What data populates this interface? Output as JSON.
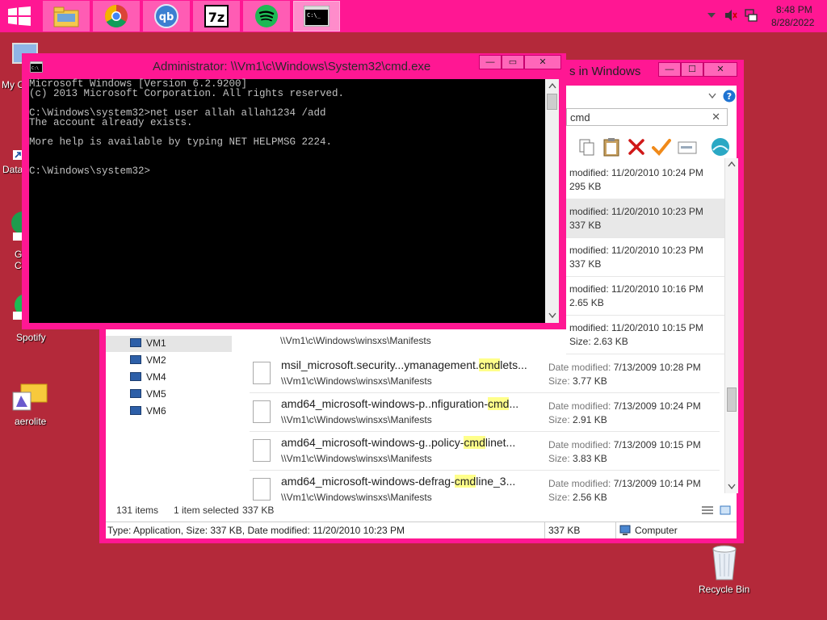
{
  "taskbar": {
    "clock_time": "8:48 PM",
    "clock_date": "8/28/2022",
    "apps": [
      "file-explorer",
      "chrome",
      "qbittorrent",
      "7zip",
      "spotify",
      "cmd"
    ]
  },
  "desktop": {
    "icons": {
      "mycomputer": "My C",
      "data": "Data",
      "g_label_1": "G",
      "g_label_2": "C",
      "spotify": "Spotify",
      "aerolite": "aerolite",
      "recycle": "Recycle Bin"
    }
  },
  "cmd": {
    "title": "Administrator: \\\\Vm1\\c\\Windows\\System32\\cmd.exe",
    "lines": [
      "Microsoft Windows [Version 6.2.9200]",
      "(c) 2013 Microsoft Corporation. All rights reserved.",
      "",
      "C:\\Windows\\system32>net user allah allah1234 /add",
      "The account already exists.",
      "",
      "More help is available by typing NET HELPMSG 2224.",
      "",
      "",
      "C:\\Windows\\system32>"
    ],
    "btn_min": "—",
    "btn_max": "▭",
    "btn_close": "✕"
  },
  "explorer": {
    "title_fragment": "s in Windows",
    "search_value": "cmd",
    "btn_min": "—",
    "btn_max": "☐",
    "btn_close": "✕",
    "tree": [
      "VM1",
      "VM2",
      "VM4",
      "VM5",
      "VM6"
    ],
    "dm_label": "Date modified:",
    "size_label": "Size:",
    "partial_rows": [
      {
        "dm": "modified: 11/20/2010 10:24 PM",
        "sz": "295 KB"
      },
      {
        "dm": "modified: 11/20/2010 10:23 PM",
        "sz": "337 KB"
      },
      {
        "dm": "modified: 11/20/2010 10:23 PM",
        "sz": "337 KB"
      },
      {
        "dm": "modified: 11/20/2010 10:16 PM",
        "sz": "2.65 KB"
      },
      {
        "dm": "modified: 11/20/2010 10:15 PM",
        "sz": "Size: 2.63 KB"
      }
    ],
    "rows": [
      {
        "pre": "msil_microsoft.security...ymanagement.",
        "hl": "cmd",
        "post": "lets...",
        "path": "\\\\Vm1\\c\\Windows\\winsxs\\Manifests",
        "date": "7/13/2009 10:28 PM",
        "size": "3.77 KB"
      },
      {
        "pre": "amd64_microsoft-windows-p..nfiguration-",
        "hl": "cmd",
        "post": "...",
        "path": "\\\\Vm1\\c\\Windows\\winsxs\\Manifests",
        "date": "7/13/2009 10:24 PM",
        "size": "2.91 KB"
      },
      {
        "pre": "amd64_microsoft-windows-g..policy-",
        "hl": "cmd",
        "post": "linet...",
        "path": "\\\\Vm1\\c\\Windows\\winsxs\\Manifests",
        "date": "7/13/2009 10:15 PM",
        "size": "3.83 KB"
      },
      {
        "pre": "amd64_microsoft-windows-defrag-",
        "hl": "cmd",
        "post": "line_3...",
        "path": "\\\\Vm1\\c\\Windows\\winsxs\\Manifests",
        "date": "7/13/2009 10:14 PM",
        "size": "2.56 KB"
      }
    ],
    "partial_path": "\\\\Vm1\\c\\Windows\\winsxs\\Manifests",
    "status_items": "131 items",
    "status_selected": "1 item selected",
    "status_size": "337 KB",
    "details_text": "Type: Application, Size: 337 KB, Date modified: 11/20/2010 10:23 PM",
    "details_size": "337 KB",
    "details_location": "Computer"
  }
}
